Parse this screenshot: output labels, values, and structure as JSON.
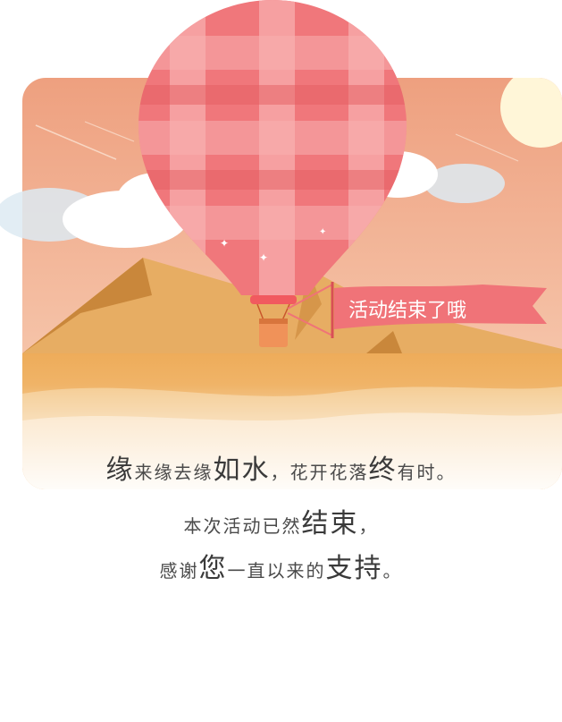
{
  "banner_text": "活动结束了哦",
  "message": {
    "line1": [
      {
        "t": "缘",
        "b": true
      },
      {
        "t": "来缘去缘",
        "b": false
      },
      {
        "t": "如水",
        "b": true
      },
      {
        "t": "，花开花落",
        "b": false
      },
      {
        "t": "终",
        "b": true
      },
      {
        "t": "有时。",
        "b": false
      }
    ],
    "line2": [
      {
        "t": "本次活动已然",
        "b": false
      },
      {
        "t": "结束",
        "b": true
      },
      {
        "t": "，",
        "b": false
      }
    ],
    "line3": [
      {
        "t": "感谢",
        "b": false
      },
      {
        "t": "您",
        "b": true
      },
      {
        "t": "一直以来的",
        "b": false
      },
      {
        "t": "支持",
        "b": true
      },
      {
        "t": "。",
        "b": false
      }
    ]
  },
  "colors": {
    "sky_top": "#f0a683",
    "sky_bottom": "#f7cdb1",
    "sand": "#f2b76a",
    "balloon": "#f07378",
    "balloon_light": "#f6a1a2",
    "banner": "#f07378",
    "sun": "#fff6d8"
  }
}
